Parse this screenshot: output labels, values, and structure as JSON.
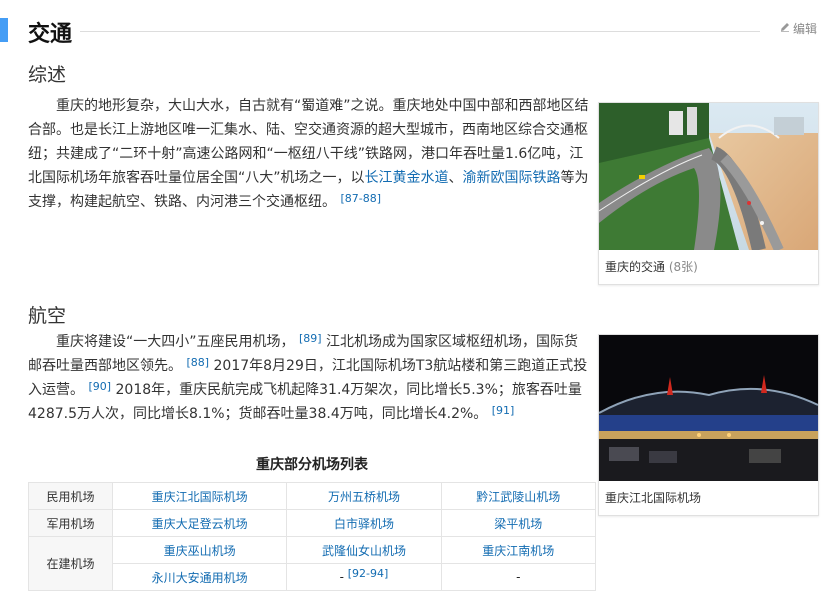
{
  "section": {
    "title": "交通",
    "edit_label": "编辑"
  },
  "overview": {
    "heading": "综述",
    "text_a": "重庆的地形复杂，大山大水，自古就有“蜀道难”之说。重庆地处中国中部和西部地区结合部。也是长江上游地区唯一汇集水、陆、空交通资源的超大型城市，西南地区综合交通枢纽；共建成了“二环十射”高速公路网和“一枢纽八干线”铁路网，港口年吞吐量1.6亿吨，江北国际机场年旅客吞吐量位居全国“八大”机场之一，以",
    "link_1": "长江黄金水道",
    "sep": "、",
    "link_2": "渝新欧国际铁路",
    "text_b": "等为支撑，构建起航空、铁路、内河港三个交通枢纽。",
    "ref": "[87-88]",
    "figure_caption": "重庆的交通",
    "figure_count": "(8张)"
  },
  "aviation": {
    "heading": "航空",
    "t1": "重庆将建设“一大四小”五座民用机场，",
    "r1": "[89]",
    "t2": "江北机场成为国家区域枢纽机场，国际货邮吞吐量西部地区领先。",
    "r2": "[88]",
    "t3": "2017年8月29日，江北国际机场T3航站楼和第三跑道正式投入运营。",
    "r3": "[90]",
    "t4": "2018年，重庆民航完成飞机起降31.4万架次，同比增长5.3%；旅客吞吐量4287.5万人次，同比增长8.1%；货邮吞吐量38.4万吨，同比增长4.2%。",
    "r4": "[91]",
    "figure_caption": "重庆江北国际机场"
  },
  "airport_table": {
    "title": "重庆部分机场列表",
    "civil": {
      "label": "民用机场",
      "items": [
        "重庆江北国际机场",
        "万州五桥机场",
        "黔江武陵山机场"
      ]
    },
    "military": {
      "label": "军用机场",
      "items": [
        "重庆大足登云机场",
        "白市驿机场",
        "梁平机场"
      ]
    },
    "construction": {
      "label": "在建机场",
      "row1": [
        "重庆巫山机场",
        "武隆仙女山机场",
        "重庆江南机场"
      ],
      "row2_link": "永川大安通用机场",
      "row2_dash": "-",
      "row2_ref": "[92-94]",
      "row2_last": "-"
    }
  }
}
